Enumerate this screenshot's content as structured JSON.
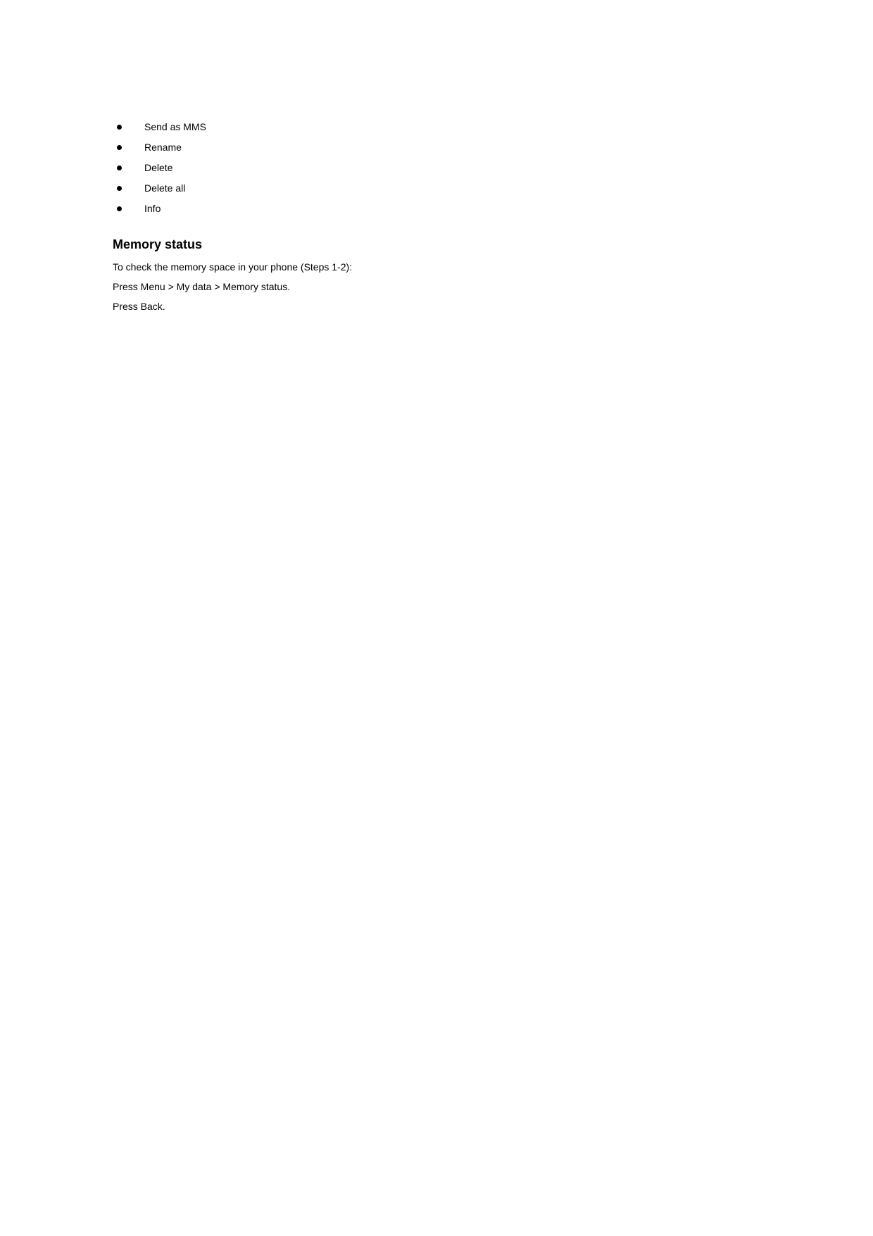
{
  "bullets": [
    "Send as MMS",
    "Rename",
    "Delete",
    "Delete all",
    "Info"
  ],
  "heading": "Memory status",
  "paragraphs": [
    "To check the memory space in your phone (Steps 1-2):",
    "Press Menu > My data > Memory status.",
    "Press Back."
  ]
}
